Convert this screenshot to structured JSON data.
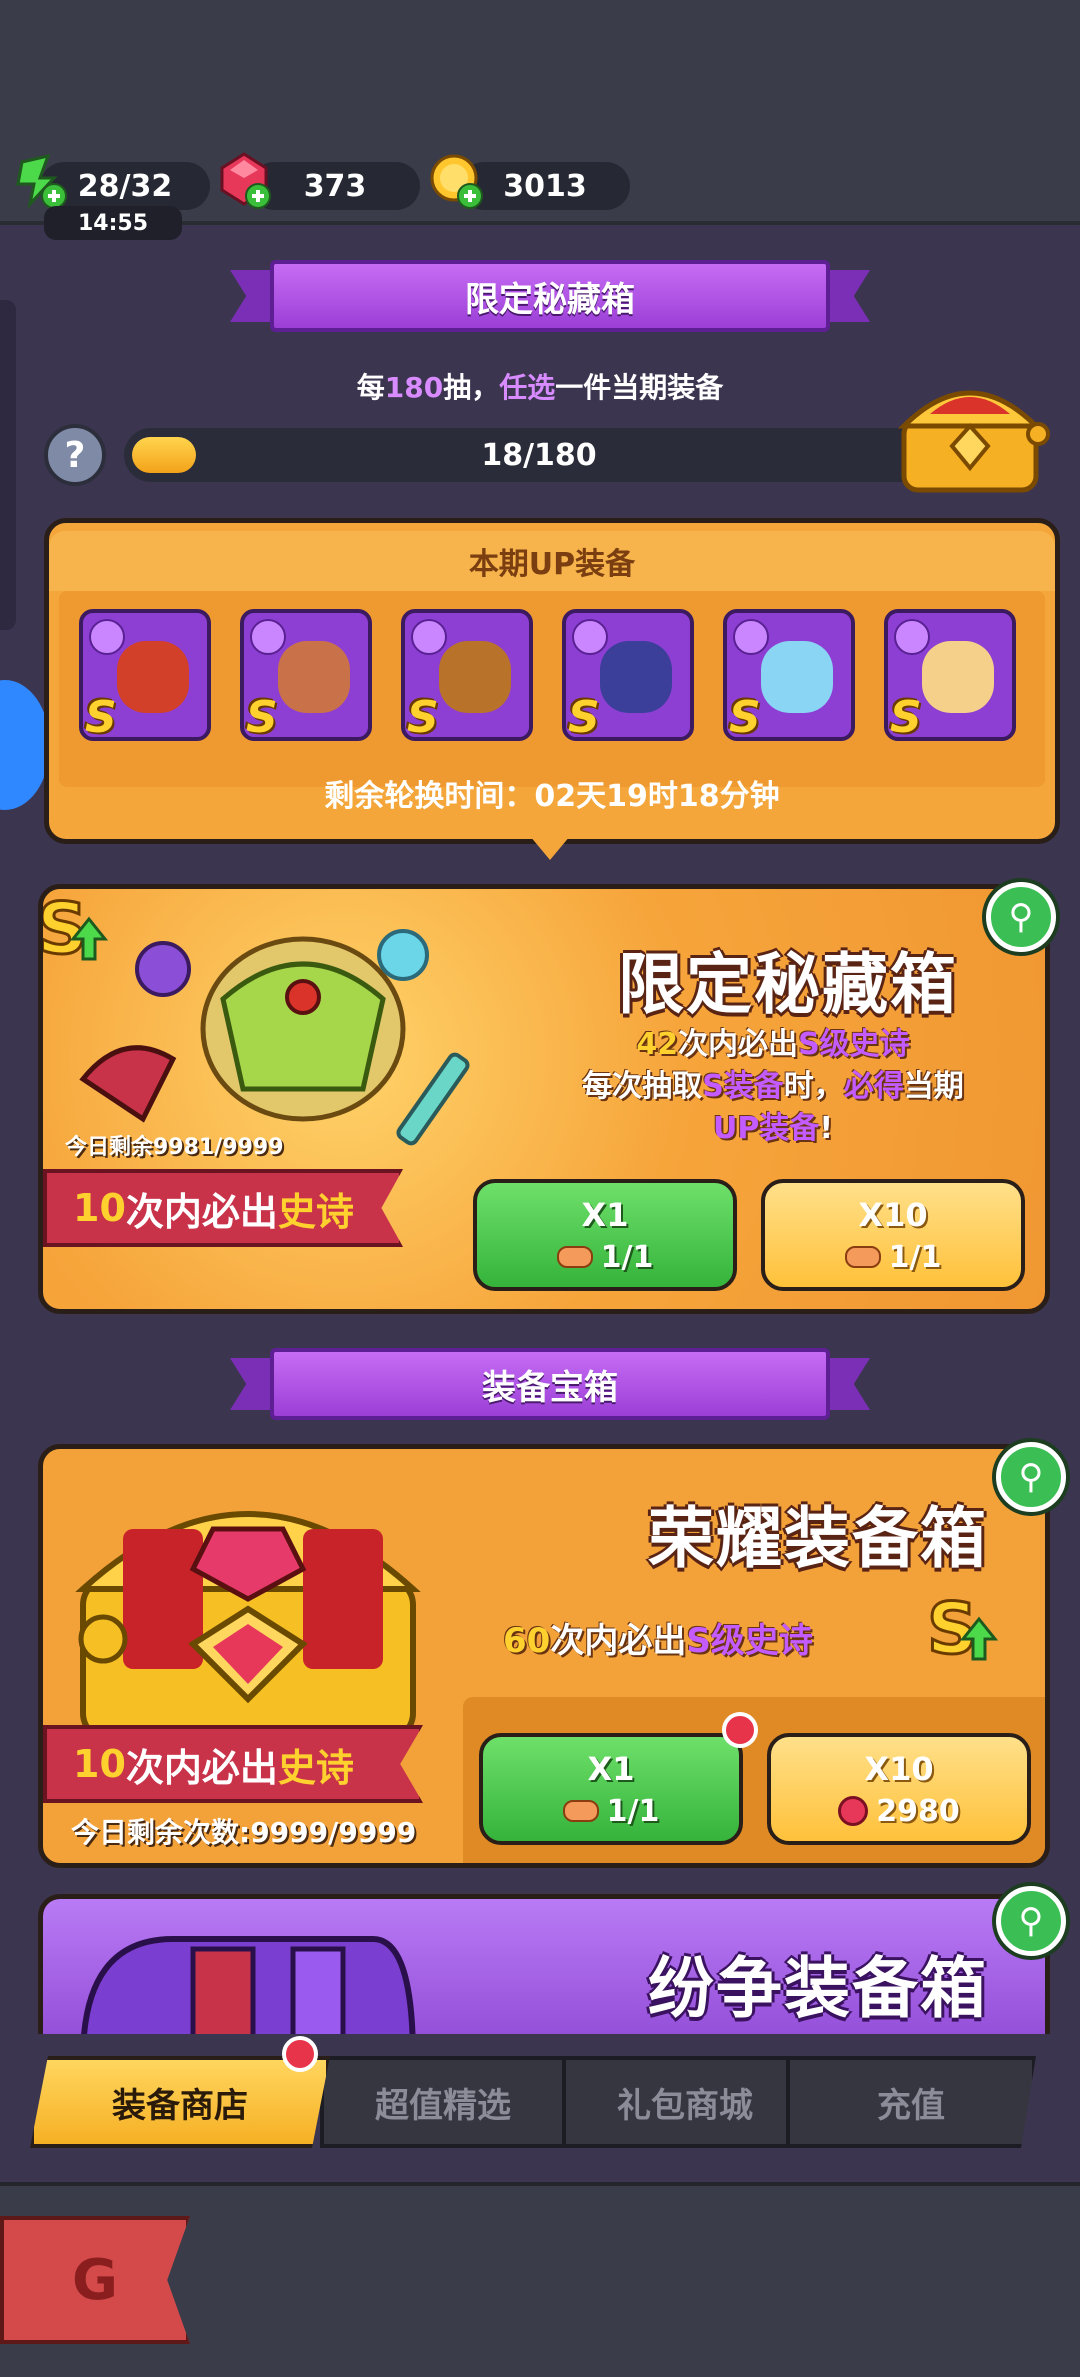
{
  "resources": {
    "energy": "28/32",
    "energy_timer": "14:55",
    "gems": "373",
    "gold": "3013"
  },
  "limited": {
    "banner": "限定秘藏箱",
    "rule_prefix": "每",
    "rule_count": "180",
    "rule_mid": "抽，",
    "rule_choose": "任选",
    "rule_suffix": "一件当期装备",
    "progress_text": "18/180",
    "progress_fraction": 0.1,
    "help": "?"
  },
  "up_panel": {
    "title": "本期UP装备",
    "grade": "S",
    "items": [
      {
        "name": "axe-item-icon",
        "color": "#d2402a"
      },
      {
        "name": "sword-item-icon",
        "color": "#c9724a"
      },
      {
        "name": "wolf-club-item-icon",
        "color": "#b8722a"
      },
      {
        "name": "dragon-armor-item-icon",
        "color": "#3b3f9a"
      },
      {
        "name": "star-ring-item-icon",
        "color": "#8ad4f4"
      },
      {
        "name": "winged-shield-item-icon",
        "color": "#f4d08a"
      }
    ],
    "rotation_label": "剩余轮换时间：",
    "rotation_value": "02天19时18分钟"
  },
  "limited_card": {
    "title": "限定秘藏箱",
    "line1_n": "42",
    "line1_a": "次内必出",
    "line1_b": "S级史诗",
    "line2_a": "每次抽取",
    "line2_b": "S装备",
    "line2_c": "时，",
    "line2_d": "必得",
    "line2_e": "当期",
    "line3_a": "UP装备",
    "line3_b": "!",
    "remain": "今日剩余9981/9999",
    "ribbon_n": "10",
    "ribbon_a": "次内必出",
    "ribbon_b": "史诗",
    "btn1_label": "X1",
    "btn1_cost": "1/1",
    "btn10_label": "X10",
    "btn10_cost": "1/1"
  },
  "equip_banner": "装备宝箱",
  "glory_card": {
    "title": "荣耀装备箱",
    "line_n": "60",
    "line_a": "次内必出",
    "line_b": "S级史诗",
    "ribbon_n": "10",
    "ribbon_a": "次内必出",
    "ribbon_b": "史诗",
    "remain": "今日剩余次数:9999/9999",
    "btn1_label": "X1",
    "btn1_cost": "1/1",
    "btn10_label": "X10",
    "btn10_cost": "2980"
  },
  "strife_card": {
    "title": "纷争装备箱"
  },
  "tabs": [
    {
      "label": "装备商店"
    },
    {
      "label": "超值精选"
    },
    {
      "label": "礼包商城"
    },
    {
      "label": "充值"
    }
  ],
  "colors": {
    "accent_purple": "#c35bff",
    "accent_yellow": "#ffd12e",
    "green_button": "#35b33b",
    "orange_panel": "#f4a63a"
  }
}
